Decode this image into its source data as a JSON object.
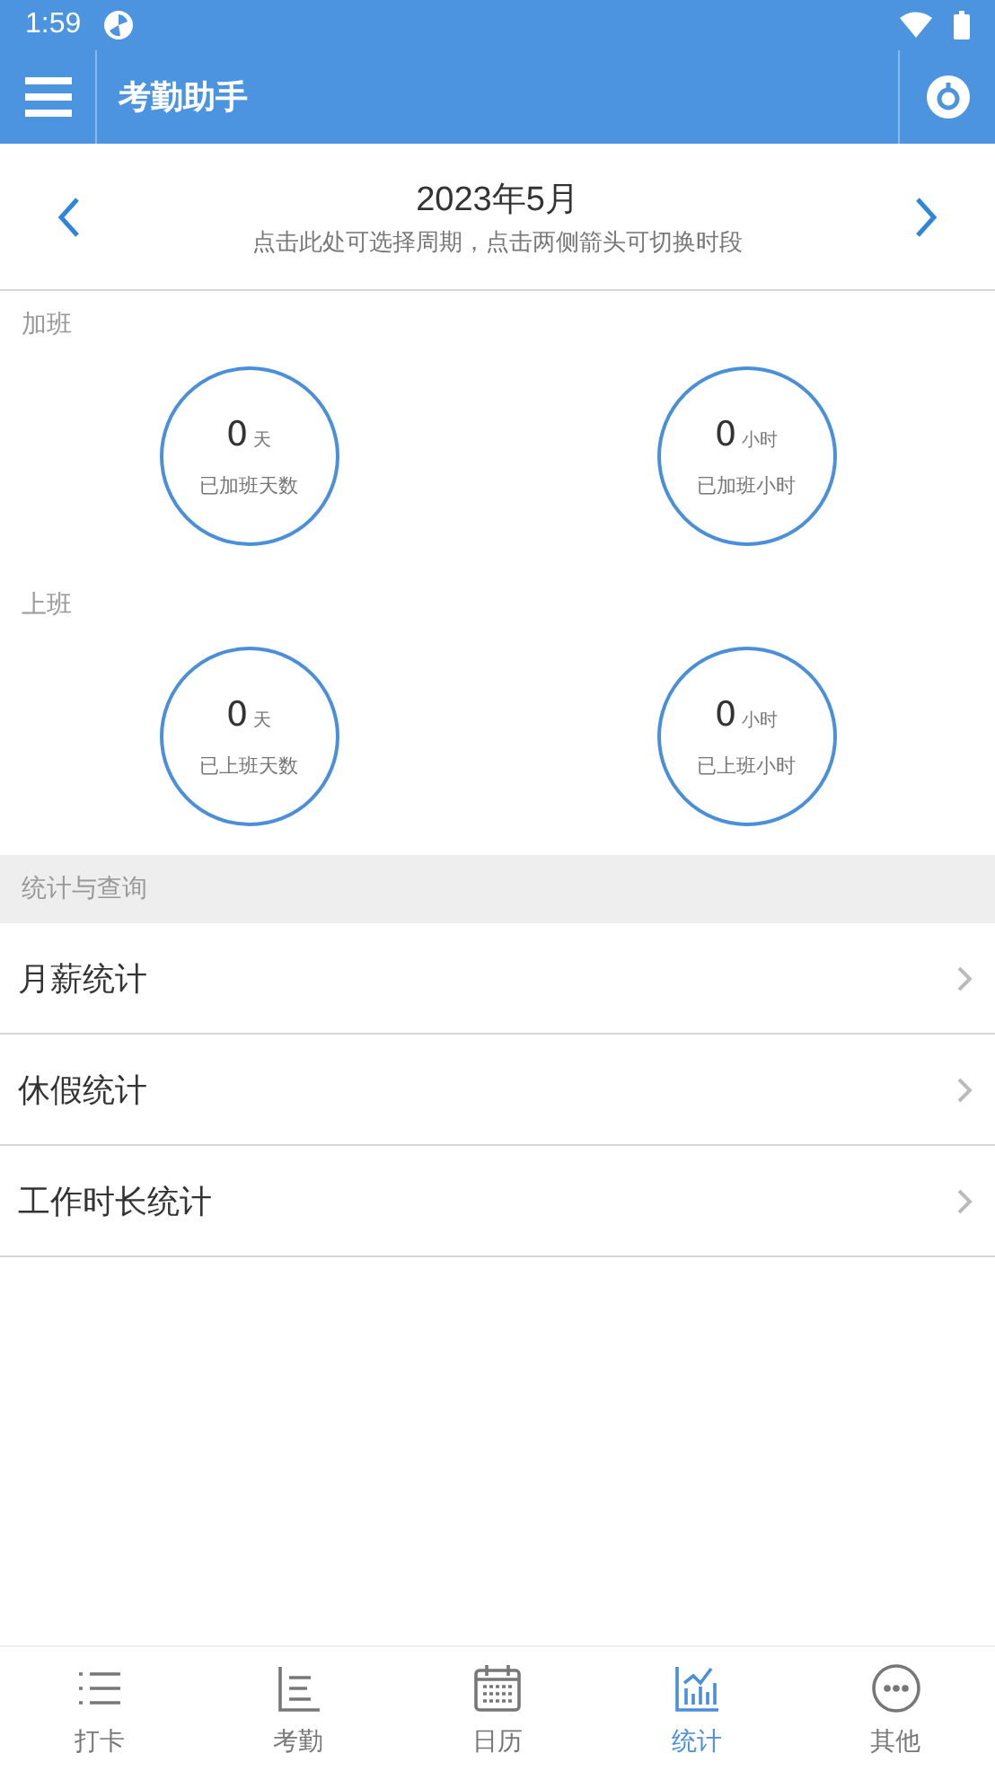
{
  "status_bar": {
    "time": "1:59"
  },
  "app_bar": {
    "title": "考勤助手"
  },
  "period": {
    "title": "2023年5月",
    "hint": "点击此处可选择周期，点击两侧箭头可切换时段"
  },
  "groups": [
    {
      "label": "加班",
      "stats": [
        {
          "value": "0",
          "unit": "天",
          "caption": "已加班天数"
        },
        {
          "value": "0",
          "unit": "小时",
          "caption": "已加班小时"
        }
      ]
    },
    {
      "label": "上班",
      "stats": [
        {
          "value": "0",
          "unit": "天",
          "caption": "已上班天数"
        },
        {
          "value": "0",
          "unit": "小时",
          "caption": "已上班小时"
        }
      ]
    }
  ],
  "section_header": "统计与查询",
  "menu_items": [
    "月薪统计",
    "休假统计",
    "工作时长统计"
  ],
  "tabs": [
    {
      "kind": "list",
      "label": "打卡",
      "selected": false
    },
    {
      "kind": "attendance",
      "label": "考勤",
      "selected": false
    },
    {
      "kind": "calendar",
      "label": "日历",
      "selected": false
    },
    {
      "kind": "chart",
      "label": "统计",
      "selected": true
    },
    {
      "kind": "more",
      "label": "其他",
      "selected": false
    }
  ]
}
